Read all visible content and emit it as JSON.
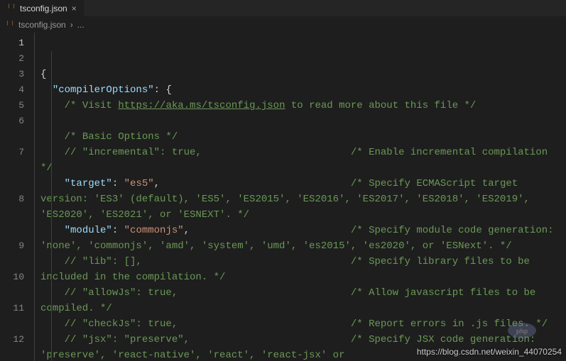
{
  "tab": {
    "filename": "tsconfig.json"
  },
  "breadcrumb": {
    "filename": "tsconfig.json",
    "sep": "›",
    "rest": "..."
  },
  "lines": {
    "l1_open": "{",
    "l2_indent": "  ",
    "l2_key": "\"compilerOptions\"",
    "l2_colon": ": ",
    "l2_brace": "{",
    "l3_indent": "    ",
    "l3_a": "/* Visit ",
    "l3_link": "https://aka.ms/tsconfig.json",
    "l3_b": " to read more about this file */",
    "l4": " ",
    "l5_indent": "    ",
    "l5": "/* Basic Options */",
    "l6_indent": "    ",
    "l6": "// \"incremental\": true,                         /* Enable incremental compilation */",
    "l7_indent": "    ",
    "l7_key": "\"target\"",
    "l7_colon": ": ",
    "l7_val": "\"es5\"",
    "l7_comma": ",",
    "l7_c": "                                /* Specify ECMAScript target version: 'ES3' (default), 'ES5', 'ES2015', 'ES2016', 'ES2017', 'ES2018', 'ES2019', 'ES2020', 'ES2021', or 'ESNEXT'. */",
    "l8_indent": "    ",
    "l8_key": "\"module\"",
    "l8_colon": ": ",
    "l8_val": "\"commonjs\"",
    "l8_comma": ",",
    "l8_c": "                           /* Specify module code generation: 'none', 'commonjs', 'amd', 'system', 'umd', 'es2015', 'es2020', or 'ESNext'. */",
    "l9_indent": "    ",
    "l9": "// \"lib\": [],                                   /* Specify library files to be included in the compilation. */",
    "l10_indent": "    ",
    "l10": "// \"allowJs\": true,                             /* Allow javascript files to be compiled. */",
    "l11_indent": "    ",
    "l11": "// \"checkJs\": true,                             /* Report errors in .js files. */",
    "l12_indent": "    ",
    "l12": "// \"jsx\": \"preserve\",                           /* Specify JSX code generation: 'preserve', 'react-native', 'react', 'react-jsx' or"
  },
  "gutter": [
    "1",
    "2",
    "3",
    "4",
    "5",
    "6",
    "7",
    "8",
    "9",
    "10",
    "11",
    "12"
  ],
  "watermark": "https://blog.csdn.net/weixin_44070254"
}
